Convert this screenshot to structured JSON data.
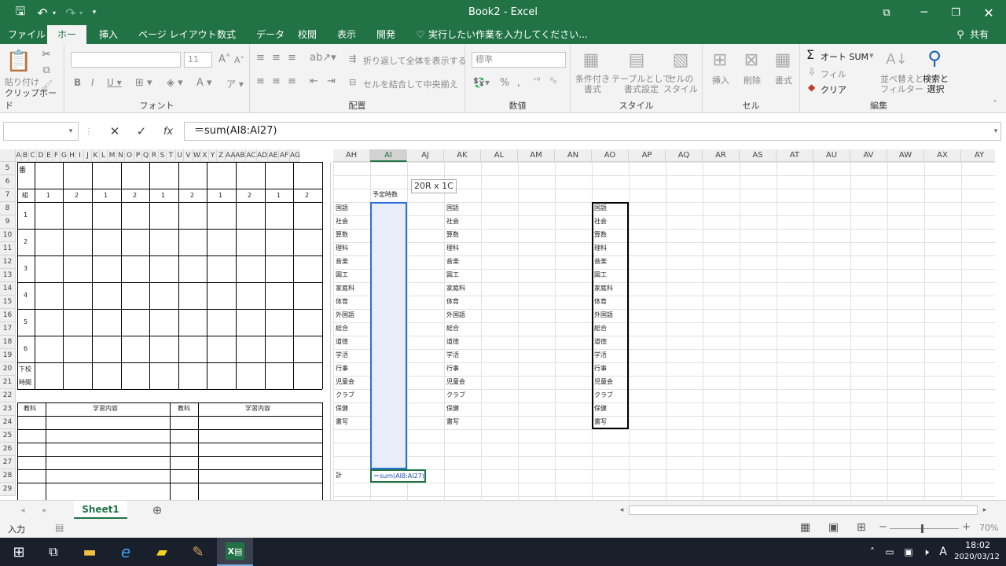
{
  "window": {
    "title": "Book2 - Excel",
    "share": "共有"
  },
  "tabs": [
    "ファイル",
    "ホーム",
    "挿入",
    "ページ レイアウト",
    "数式",
    "データ",
    "校閲",
    "表示",
    "開発"
  ],
  "tell_me": "実行したい作業を入力してください...",
  "ribbon": {
    "clipboard": {
      "label": "クリップボード",
      "paste": "貼り付け"
    },
    "font": {
      "label": "フォント",
      "size": "11"
    },
    "alignment": {
      "label": "配置",
      "wrap": "折り返して全体を表示する",
      "merge": "セルを結合して中央揃え"
    },
    "number": {
      "label": "数値",
      "format": "標準"
    },
    "styles": {
      "label": "スタイル",
      "conditional": "条件付き\n書式",
      "table": "テーブルとして\n書式設定",
      "cell": "セルの\nスタイル"
    },
    "cells": {
      "label": "セル",
      "insert": "挿入",
      "delete": "削除",
      "format": "書式"
    },
    "editing": {
      "label": "編集",
      "autosum": "オート SUM",
      "fill": "フィル",
      "clear": "クリア",
      "sort": "並べ替えと\nフィルター",
      "find": "検索と\n選択"
    }
  },
  "formula": "＝sum(AI8:AI27)",
  "columns_left": [
    "A",
    "B",
    "C",
    "D",
    "E",
    "F",
    "G",
    "H",
    "I",
    "J",
    "K",
    "L",
    "M",
    "N",
    "O",
    "P",
    "Q",
    "R",
    "S",
    "T",
    "U",
    "V",
    "W",
    "X",
    "Y",
    "Z",
    "AA",
    "AB",
    "AC",
    "AD",
    "AE",
    "AF",
    "AG"
  ],
  "columns_right": [
    "AH",
    "AI",
    "AJ",
    "AK",
    "AL",
    "AM",
    "AN",
    "AO",
    "AP",
    "AQ",
    "AR",
    "AS",
    "AT",
    "AU",
    "AV",
    "AW",
    "AX",
    "AY"
  ],
  "rows": [
    "5",
    "6",
    "7",
    "8",
    "9",
    "10",
    "11",
    "12",
    "13",
    "14",
    "15",
    "16",
    "17",
    "18",
    "19",
    "20",
    "21",
    "22",
    "23",
    "24",
    "25",
    "26",
    "27",
    "28",
    "29"
  ],
  "timetable": {
    "ban": "番",
    "kumi": "組",
    "classes": [
      "1",
      "2",
      "1",
      "2",
      "1",
      "2",
      "1",
      "2",
      "1",
      "2"
    ],
    "periods": [
      "1",
      "2",
      "3",
      "4",
      "5",
      "6"
    ],
    "after_school": [
      "下校",
      "時間"
    ],
    "subject_hdr": "教科",
    "content_hdr": "学習内容"
  },
  "subjects": [
    "国語",
    "社会",
    "算数",
    "理科",
    "音楽",
    "図工",
    "家庭科",
    "体育",
    "外国語",
    "総合",
    "道徳",
    "学活",
    "行事",
    "児童会",
    "クラブ",
    "保健",
    "書写"
  ],
  "planned_hours": "予定時数",
  "tooltip": "20R x 1C",
  "total_label": "計",
  "sheet": {
    "name": "Sheet1"
  },
  "status": {
    "mode": "入力",
    "zoom": "70%"
  },
  "clock": {
    "time": "18:02",
    "date": "2020/03/12"
  },
  "ime": "A",
  "colors": {
    "excel_green": "#217346",
    "selection_fill": "#e8eef9",
    "selection_border": "#2a6fd6"
  }
}
